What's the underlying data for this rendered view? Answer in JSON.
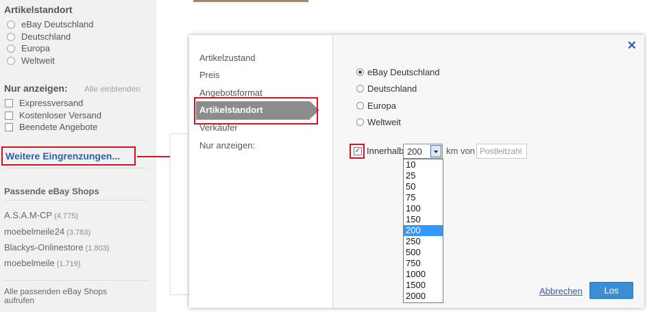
{
  "sidebar": {
    "location_heading": "Artikelstandort",
    "location_options": [
      "eBay Deutschland",
      "Deutschland",
      "Europa",
      "Weltweit"
    ],
    "show_heading": "Nur anzeigen:",
    "show_all_link": "Alle einblenden",
    "show_options": [
      "Expressversand",
      "Kostenloser Versand",
      "Beendete Angebote"
    ],
    "more_filters": "Weitere Eingrenzungen...",
    "shops_heading": "Passende eBay Shops",
    "shops": [
      {
        "name": "A.S.A.M-CP",
        "count": "(4.775)"
      },
      {
        "name": "moebelmeile24",
        "count": "(3.783)"
      },
      {
        "name": "Blackys-Onlinestore",
        "count": "(1.803)"
      },
      {
        "name": "moebelmeile",
        "count": "(1.719)"
      }
    ],
    "all_shops_link": "Alle passenden eBay Shops aufrufen"
  },
  "modal": {
    "nav": {
      "items": [
        "Artikelzustand",
        "Preis",
        "Angebotsformat",
        "Artikelstandort",
        "Verkäufer",
        "Nur anzeigen:"
      ],
      "active": "Artikelstandort"
    },
    "location_options": [
      "eBay Deutschland",
      "Deutschland",
      "Europa",
      "Weltweit"
    ],
    "selected_location": "eBay Deutschland",
    "distance": {
      "checked": true,
      "label": "Innerhalb",
      "selected": "200",
      "unit_label": "km von",
      "zip_placeholder": "Postleitzahl",
      "options": [
        "10",
        "25",
        "50",
        "75",
        "100",
        "150",
        "200",
        "250",
        "500",
        "750",
        "1000",
        "1500",
        "2000"
      ]
    },
    "cancel_label": "Abbrechen",
    "submit_label": "Los",
    "close_glyph": "✕"
  },
  "colors": {
    "highlight_red": "#d3121f",
    "link_blue": "#2f5fa8",
    "button_blue": "#3b8ed3",
    "nav_active_grey": "#8c8c8c"
  }
}
